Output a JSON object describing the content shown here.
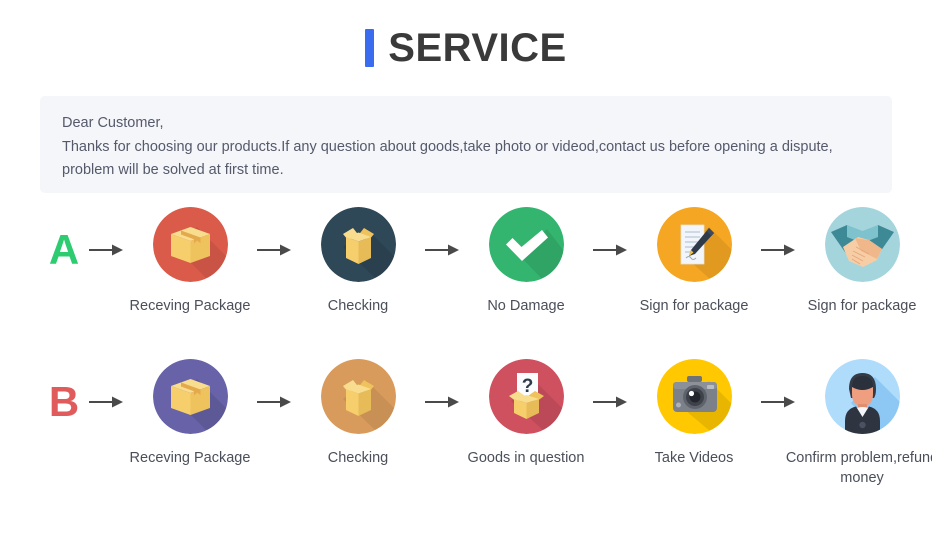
{
  "header": {
    "title": "SERVICE",
    "accent_color": "#3b6cf0"
  },
  "notice": {
    "line1": "Dear Customer,",
    "line2": "Thanks for choosing our products.If any question about goods,take photo or videod,contact us before opening a dispute,",
    "line3": "problem will be solved at first time.",
    "background": "#f5f6fa",
    "text_color": "#55596a"
  },
  "rows": [
    {
      "letter": "A",
      "letter_color": "#2ecc71",
      "steps": [
        {
          "label": "Receving Package",
          "icon": "closed-box-icon",
          "circle_color": "#db5b4a"
        },
        {
          "label": "Checking",
          "icon": "open-box-icon",
          "circle_color": "#2f4858"
        },
        {
          "label": "No Damage",
          "icon": "check-mark-icon",
          "circle_color": "#34b56f"
        },
        {
          "label": "Sign for package",
          "icon": "document-pen-icon",
          "circle_color": "#f5a623"
        },
        {
          "label": "Sign for package",
          "icon": "handshake-icon",
          "circle_color": "#a5d5dc"
        }
      ]
    },
    {
      "letter": "B",
      "letter_color": "#e05c5c",
      "steps": [
        {
          "label": "Receving Package",
          "icon": "closed-box-icon",
          "circle_color": "#6863a8"
        },
        {
          "label": "Checking",
          "icon": "open-box-icon",
          "circle_color": "#d89b5c"
        },
        {
          "label": "Goods in question",
          "icon": "question-box-icon",
          "circle_color": "#cf5160"
        },
        {
          "label": "Take Videos",
          "icon": "camera-icon",
          "circle_color": "#ffc800"
        },
        {
          "label": "Confirm  problem,refund money",
          "icon": "person-support-icon",
          "circle_color": "#aedcfa"
        }
      ]
    }
  ],
  "arrow": {
    "color": "#4a4a4a",
    "name": "right-arrow-icon"
  }
}
